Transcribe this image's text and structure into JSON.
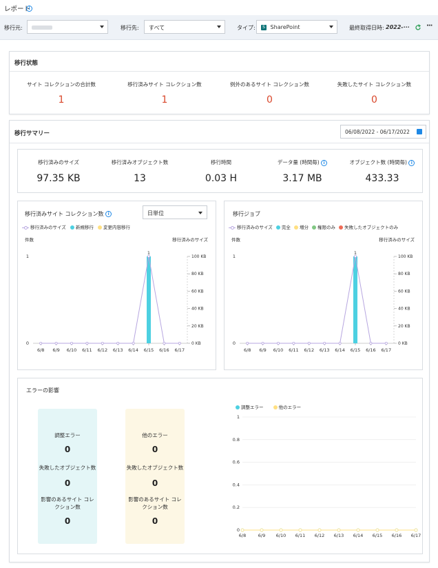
{
  "page_title": "レポート",
  "filters": {
    "source_label": "移行元:",
    "source_value": "",
    "dest_label": "移行先:",
    "dest_value": "すべて",
    "type_label": "タイプ:",
    "type_value": "SharePoint",
    "last_fetch_label": "最終取得日時:",
    "last_fetch_value": "2022-···"
  },
  "migration_status": {
    "title": "移行状態",
    "stats": [
      {
        "label": "サイト コレクションの合計数",
        "value": "1"
      },
      {
        "label": "移行済みサイト コレクション数",
        "value": "1"
      },
      {
        "label": "例外のあるサイト コレクション数",
        "value": "0"
      },
      {
        "label": "失敗したサイト コレクション数",
        "value": "0"
      }
    ]
  },
  "migration_summary": {
    "title": "移行サマリー",
    "date_range": "06/08/2022 - 06/17/2022",
    "stats": [
      {
        "label": "移行済みのサイズ",
        "value": "97.35 KB"
      },
      {
        "label": "移行済みオブジェクト数",
        "value": "13"
      },
      {
        "label": "移行時間",
        "value": "0.03 H"
      },
      {
        "label": "データ量 (時間毎)",
        "value": "3.17 MB"
      },
      {
        "label": "オブジェクト数 (時間毎)",
        "value": "433.33"
      }
    ]
  },
  "colors": {
    "cyan": "#4dd0e1",
    "yellow": "#ffe082",
    "green": "#81c784",
    "red": "#ef6c57",
    "purple": "#b7a6e0",
    "accent_red": "#d9472b"
  },
  "chart_data": [
    {
      "type": "bar",
      "title": "移行済みサイト コレクション数",
      "granularity": "日単位",
      "legend": [
        "移行済みのサイズ",
        "新規移行",
        "変更内容移行"
      ],
      "ylabel_left": "件数",
      "ylabel_right": "移行済みのサイズ",
      "categories": [
        "6/8",
        "6/9",
        "6/10",
        "6/11",
        "6/12",
        "6/13",
        "6/14",
        "6/15",
        "6/16",
        "6/17"
      ],
      "y_left_ticks": [
        "0",
        "1"
      ],
      "y_right_ticks": [
        "0 KB",
        "20 KB",
        "40 KB",
        "60 KB",
        "80 KB",
        "100 KB"
      ],
      "series": [
        {
          "name": "新規移行",
          "values": [
            0,
            0,
            0,
            0,
            0,
            0,
            0,
            1,
            0,
            0
          ]
        },
        {
          "name": "移行済みのサイズ",
          "values": [
            0,
            0,
            0,
            0,
            0,
            0,
            0,
            100,
            0,
            0
          ]
        }
      ],
      "bar_label": "1"
    },
    {
      "type": "bar",
      "title": "移行ジョブ",
      "legend": [
        "移行済みのサイズ",
        "完全",
        "増分",
        "権限のみ",
        "失敗したオブジェクトのみ"
      ],
      "ylabel_left": "件数",
      "ylabel_right": "移行済みのサイズ",
      "categories": [
        "6/8",
        "6/9",
        "6/10",
        "6/11",
        "6/12",
        "6/13",
        "6/14",
        "6/15",
        "6/16",
        "6/17"
      ],
      "y_left_ticks": [
        "0",
        "1"
      ],
      "y_right_ticks": [
        "0 KB",
        "20 KB",
        "40 KB",
        "60 KB",
        "80 KB",
        "100 KB"
      ],
      "series": [
        {
          "name": "完全",
          "values": [
            0,
            0,
            0,
            0,
            0,
            0,
            0,
            1,
            0,
            0
          ]
        },
        {
          "name": "移行済みのサイズ",
          "values": [
            0,
            0,
            0,
            0,
            0,
            0,
            0,
            100,
            0,
            0
          ]
        }
      ],
      "bar_label": "1"
    },
    {
      "type": "line",
      "legend": [
        "調整エラー",
        "他のエラー"
      ],
      "categories": [
        "6/8",
        "6/9",
        "6/10",
        "6/11",
        "6/12",
        "6/13",
        "6/14",
        "6/15",
        "6/16",
        "6/17"
      ],
      "y_ticks": [
        "0",
        "0.2",
        "0.4",
        "0.6",
        "0.8",
        "1"
      ],
      "series": [
        {
          "name": "調整エラー",
          "values": [
            0,
            0,
            0,
            0,
            0,
            0,
            0,
            0,
            0,
            0
          ]
        },
        {
          "name": "他のエラー",
          "values": [
            0,
            0,
            0,
            0,
            0,
            0,
            0,
            0,
            0,
            0
          ]
        }
      ]
    }
  ],
  "error_impact": {
    "title": "エラーの影響",
    "box1": [
      {
        "label": "調整エラー",
        "value": "0"
      },
      {
        "label": "失敗したオブジェクト数",
        "value": "0"
      },
      {
        "label": "影響のあるサイト コレクション数",
        "value": "0"
      }
    ],
    "box2": [
      {
        "label": "他のエラー",
        "value": "0"
      },
      {
        "label": "失敗したオブジェクト数",
        "value": "0"
      },
      {
        "label": "影響のあるサイト コレクション数",
        "value": "0"
      }
    ]
  }
}
